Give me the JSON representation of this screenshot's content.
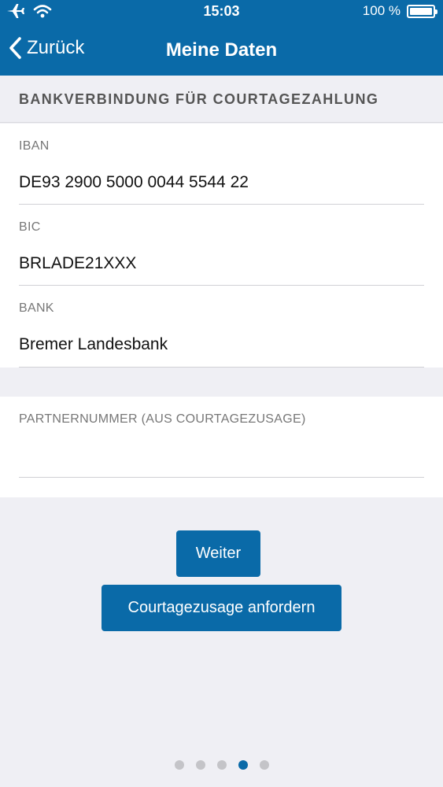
{
  "status_bar": {
    "time": "15:03",
    "battery": "100 %",
    "icons": [
      "airplane-icon",
      "wifi-icon",
      "battery-icon"
    ]
  },
  "nav": {
    "back_label": "Zurück",
    "title": "Meine Daten"
  },
  "section": {
    "title": "BANKVERBINDUNG FÜR COURTAGEZAHLUNG"
  },
  "fields": {
    "iban": {
      "label": "IBAN",
      "value": "DE93 2900 5000 0044 5544 22"
    },
    "bic": {
      "label": "BIC",
      "value": "BRLADE21XXX"
    },
    "bank": {
      "label": "BANK",
      "value": "Bremer Landesbank"
    },
    "partner": {
      "label": "PARTNERNUMMER (AUS COURTAGEZUSAGE)",
      "value": ""
    }
  },
  "buttons": {
    "next": "Weiter",
    "request": "Courtagezusage anfordern"
  },
  "pager": {
    "total": 5,
    "active": 4
  },
  "colors": {
    "accent": "#0a6aa8",
    "background": "#efeff4"
  }
}
